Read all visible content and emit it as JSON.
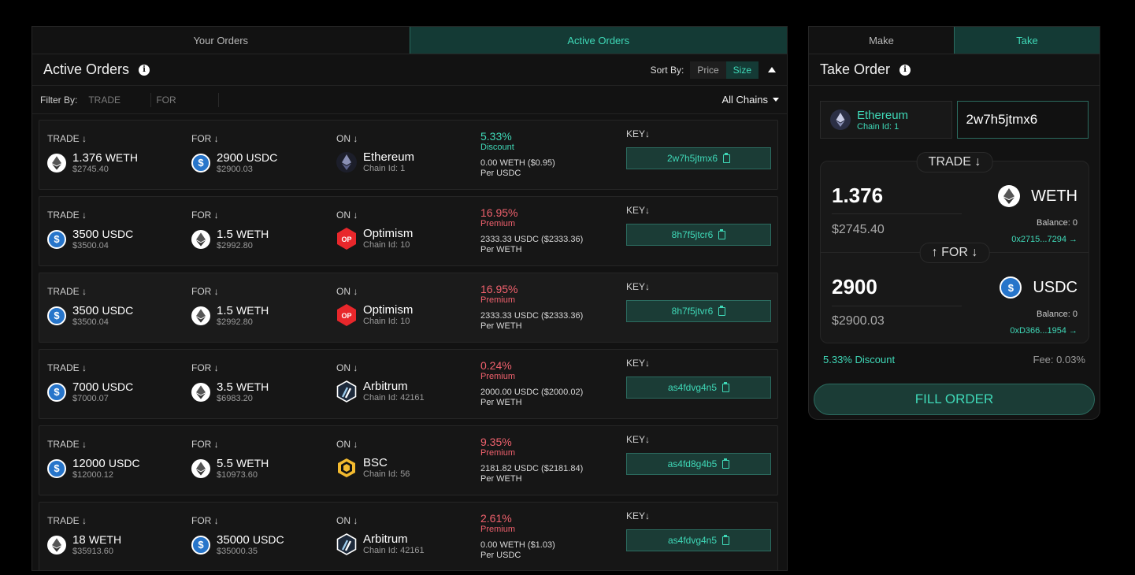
{
  "left_tabs": [
    "Your Orders",
    "Active Orders"
  ],
  "list_header": {
    "title": "Active Orders",
    "sort_label": "Sort By:",
    "sort_options": [
      "Price",
      "Size"
    ]
  },
  "filter": {
    "label": "Filter By:",
    "trade_placeholder": "TRADE",
    "for_placeholder": "FOR",
    "chains": "All Chains"
  },
  "labels": {
    "trade": "TRADE ↓",
    "for": "FOR ↓",
    "on": "ON ↓",
    "key": "KEY↓",
    "chain_id_prefix": "Chain Id:"
  },
  "orders": [
    {
      "trade_amt": "1.376",
      "trade_sym": "WETH",
      "trade_usd": "$2745.40",
      "for_amt": "2900",
      "for_sym": "USDC",
      "for_usd": "$2900.03",
      "chain": "Ethereum",
      "chain_id": "Chain Id: 1",
      "pct": "5.33%",
      "pct_label": "Discount",
      "rate": "0.00 WETH ($0.95)",
      "rate_unit": "Per USDC",
      "key": "2w7h5jtmx6"
    },
    {
      "trade_amt": "3500",
      "trade_sym": "USDC",
      "trade_usd": "$3500.04",
      "for_amt": "1.5",
      "for_sym": "WETH",
      "for_usd": "$2992.80",
      "chain": "Optimism",
      "chain_id": "Chain Id: 10",
      "pct": "16.95%",
      "pct_label": "Premium",
      "rate": "2333.33 USDC ($2333.36)",
      "rate_unit": "Per WETH",
      "key": "8h7f5jtcr6"
    },
    {
      "trade_amt": "3500",
      "trade_sym": "USDC",
      "trade_usd": "$3500.04",
      "for_amt": "1.5",
      "for_sym": "WETH",
      "for_usd": "$2992.80",
      "chain": "Optimism",
      "chain_id": "Chain Id: 10",
      "pct": "16.95%",
      "pct_label": "Premium",
      "rate": "2333.33 USDC ($2333.36)",
      "rate_unit": "Per WETH",
      "key": "8h7f5jtvr6"
    },
    {
      "trade_amt": "7000",
      "trade_sym": "USDC",
      "trade_usd": "$7000.07",
      "for_amt": "3.5",
      "for_sym": "WETH",
      "for_usd": "$6983.20",
      "chain": "Arbitrum",
      "chain_id": "Chain Id: 42161",
      "pct": "0.24%",
      "pct_label": "Premium",
      "rate": "2000.00 USDC ($2000.02)",
      "rate_unit": "Per WETH",
      "key": "as4fdvg4n5"
    },
    {
      "trade_amt": "12000",
      "trade_sym": "USDC",
      "trade_usd": "$12000.12",
      "for_amt": "5.5",
      "for_sym": "WETH",
      "for_usd": "$10973.60",
      "chain": "BSC",
      "chain_id": "Chain Id: 56",
      "pct": "9.35%",
      "pct_label": "Premium",
      "rate": "2181.82 USDC ($2181.84)",
      "rate_unit": "Per WETH",
      "key": "as4fd8g4b5"
    },
    {
      "trade_amt": "18",
      "trade_sym": "WETH",
      "trade_usd": "$35913.60",
      "for_amt": "35000",
      "for_sym": "USDC",
      "for_usd": "$35000.35",
      "chain": "Arbitrum",
      "chain_id": "Chain Id: 42161",
      "pct": "2.61%",
      "pct_label": "Premium",
      "rate": "0.00 WETH ($1.03)",
      "rate_unit": "Per USDC",
      "key": "as4fdvg4n5"
    }
  ],
  "right_tabs": [
    "Make",
    "Take"
  ],
  "take": {
    "title": "Take Order",
    "chain": "Ethereum",
    "chain_id": "Chain Id: 1",
    "key_value": "2w7h5jtmx6",
    "trade_pill": "TRADE ↓",
    "for_pill": "↑ FOR ↓",
    "trade_amount": "1.376",
    "trade_usd": "$2745.40",
    "trade_token": "WETH",
    "trade_balance": "Balance: 0",
    "trade_addr": "0x2715...7294 →",
    "for_amount": "2900",
    "for_usd": "$2900.03",
    "for_token": "USDC",
    "for_balance": "Balance: 0",
    "for_addr": "0xD366...1954 →",
    "discount": "5.33% Discount",
    "fee": "Fee: 0.03%",
    "fill_label": "FILL ORDER"
  },
  "colors": {
    "accent": "#3fd9b8",
    "premium": "#f0616d",
    "accent_bg": "#143a35"
  }
}
